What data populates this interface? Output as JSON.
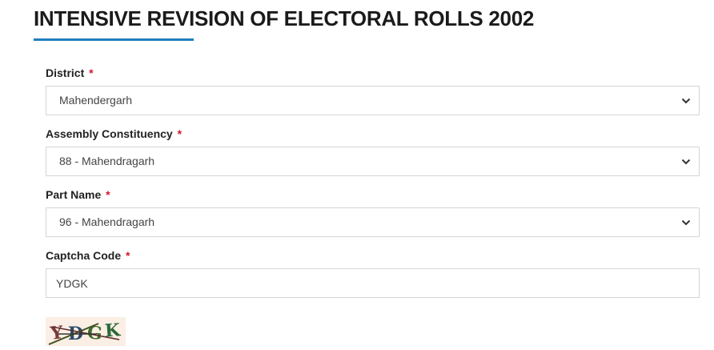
{
  "page": {
    "title": "INTENSIVE REVISION OF ELECTORAL ROLLS 2002"
  },
  "form": {
    "required_marker": "*",
    "district": {
      "label": "District",
      "selected": "Mahendergarh"
    },
    "assembly_constituency": {
      "label": "Assembly Constituency",
      "selected": "88 - Mahendragarh"
    },
    "part_name": {
      "label": "Part Name",
      "selected": "96 - Mahendragarh"
    },
    "captcha_code": {
      "label": "Captcha Code",
      "value": "YDGK"
    },
    "captcha_image": {
      "text": "YDGK"
    }
  },
  "colors": {
    "accent": "#1f7fbf",
    "required": "#d0192a"
  }
}
